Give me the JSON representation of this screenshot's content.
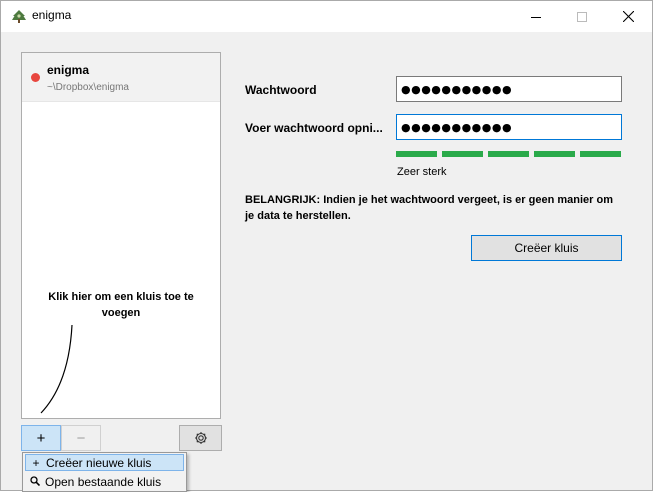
{
  "window": {
    "title": "enigma"
  },
  "sidebar": {
    "vaults": [
      {
        "name": "enigma",
        "path": "~\\Dropbox\\enigma",
        "status_color": "#e8473f"
      }
    ],
    "hint": "Klik hier om een kluis toe te voegen"
  },
  "toolbar": {
    "add_label": "+",
    "remove_label": "−"
  },
  "add_menu": {
    "items": [
      {
        "label": "Creëer nieuwe kluis",
        "icon": "plus-icon",
        "glyph": "+"
      },
      {
        "label": "Open bestaande kluis",
        "icon": "search-icon",
        "glyph": "🔍"
      }
    ]
  },
  "form": {
    "password_label": "Wachtwoord",
    "password_value": "●●●●●●●●●●●",
    "confirm_label": "Voer wachtwoord opni...",
    "confirm_value": "●●●●●●●●●●●",
    "strength_label": "Zeer sterk",
    "strength_level": 1.0,
    "strength_segments": 5,
    "strength_color": "#2aaa4a",
    "important_text": "BELANGRIJK: Indien je het wachtwoord vergeet, is er geen manier om je data te herstellen.",
    "create_button": "Creëer kluis"
  }
}
